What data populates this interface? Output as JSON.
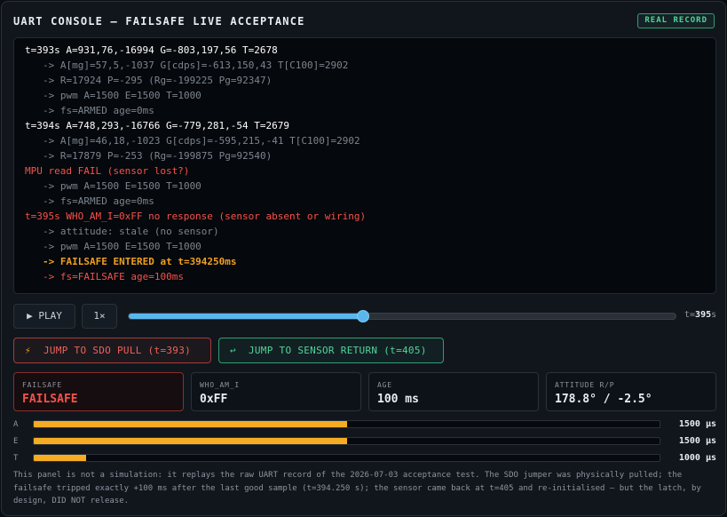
{
  "header": {
    "title": "UART CONSOLE — FAILSAFE LIVE ACCEPTANCE",
    "badge": "REAL RECORD"
  },
  "console": {
    "lines": [
      {
        "type": "main",
        "text": "t=393s A=931,76,-16994 G=-803,197,56 T=2678"
      },
      {
        "type": "sub",
        "text": "-> A[mg]=57,5,-1037 G[cdps]=-613,150,43 T[C100]=2902"
      },
      {
        "type": "sub",
        "text": "-> R=17924 P=-295 (Rg=-199225 Pg=92347)"
      },
      {
        "type": "sub",
        "text": "-> pwm A=1500 E=1500 T=1000"
      },
      {
        "type": "sub",
        "text": "-> fs=ARMED age=0ms"
      },
      {
        "type": "main",
        "text": "t=394s A=748,293,-16766 G=-779,281,-54 T=2679"
      },
      {
        "type": "sub",
        "text": "-> A[mg]=46,18,-1023 G[cdps]=-595,215,-41 T[C100]=2902"
      },
      {
        "type": "sub",
        "text": "-> R=17879 P=-253 (Rg=-199875 Pg=92540)"
      },
      {
        "type": "err",
        "text": "MPU read FAIL (sensor lost?)"
      },
      {
        "type": "sub",
        "text": "-> pwm A=1500 E=1500 T=1000"
      },
      {
        "type": "sub",
        "text": "-> fs=ARMED age=0ms"
      },
      {
        "type": "err",
        "text": "t=395s WHO_AM_I=0xFF no response (sensor absent or wiring)"
      },
      {
        "type": "sub",
        "text": "-> attitude: stale (no sensor)"
      },
      {
        "type": "sub",
        "text": "-> pwm A=1500 E=1500 T=1000"
      },
      {
        "type": "warn",
        "text": "-> FAILSAFE ENTERED at t=394250ms"
      },
      {
        "type": "errsub",
        "text": "-> fs=FAILSAFE age=100ms"
      }
    ]
  },
  "controls": {
    "play_label": "▶ PLAY",
    "speed_label": "1×",
    "slider_fraction": 0.428,
    "slider_prefix": "t=",
    "slider_value": "395",
    "slider_unit": "s"
  },
  "jumps": {
    "sdo_icon": "⚡",
    "sdo_label": "JUMP TO SDO PULL (t=393)",
    "return_icon": "↩",
    "return_label": "JUMP TO SENSOR RETURN (t=405)"
  },
  "cards": [
    {
      "label": "FAILSAFE",
      "value": "FAILSAFE"
    },
    {
      "label": "WHO_AM_I",
      "value": "0xFF"
    },
    {
      "label": "AGE",
      "value": "100 ms"
    },
    {
      "label": "ATTITUDE R/P",
      "value": "178.8° / -2.5°"
    }
  ],
  "bars": [
    {
      "name": "A",
      "value": "1500 µs",
      "fraction": 0.5
    },
    {
      "name": "E",
      "value": "1500 µs",
      "fraction": 0.5
    },
    {
      "name": "T",
      "value": "1000 µs",
      "fraction": 0.083
    }
  ],
  "note": "This panel is not a simulation: it replays the raw UART record of the 2026-07-03 acceptance test. The SDO jumper was physically pulled; the failsafe tripped exactly +100 ms after the last good sample (t=394.250 s); the sensor came back at t=405 and re-initialised — but the latch, by design, DID NOT release.",
  "colors": {
    "accent": "#5ab7ee",
    "error": "#f85149",
    "warning": "#f0a020",
    "success": "#4fd59a",
    "bar": "#f5ac23"
  }
}
